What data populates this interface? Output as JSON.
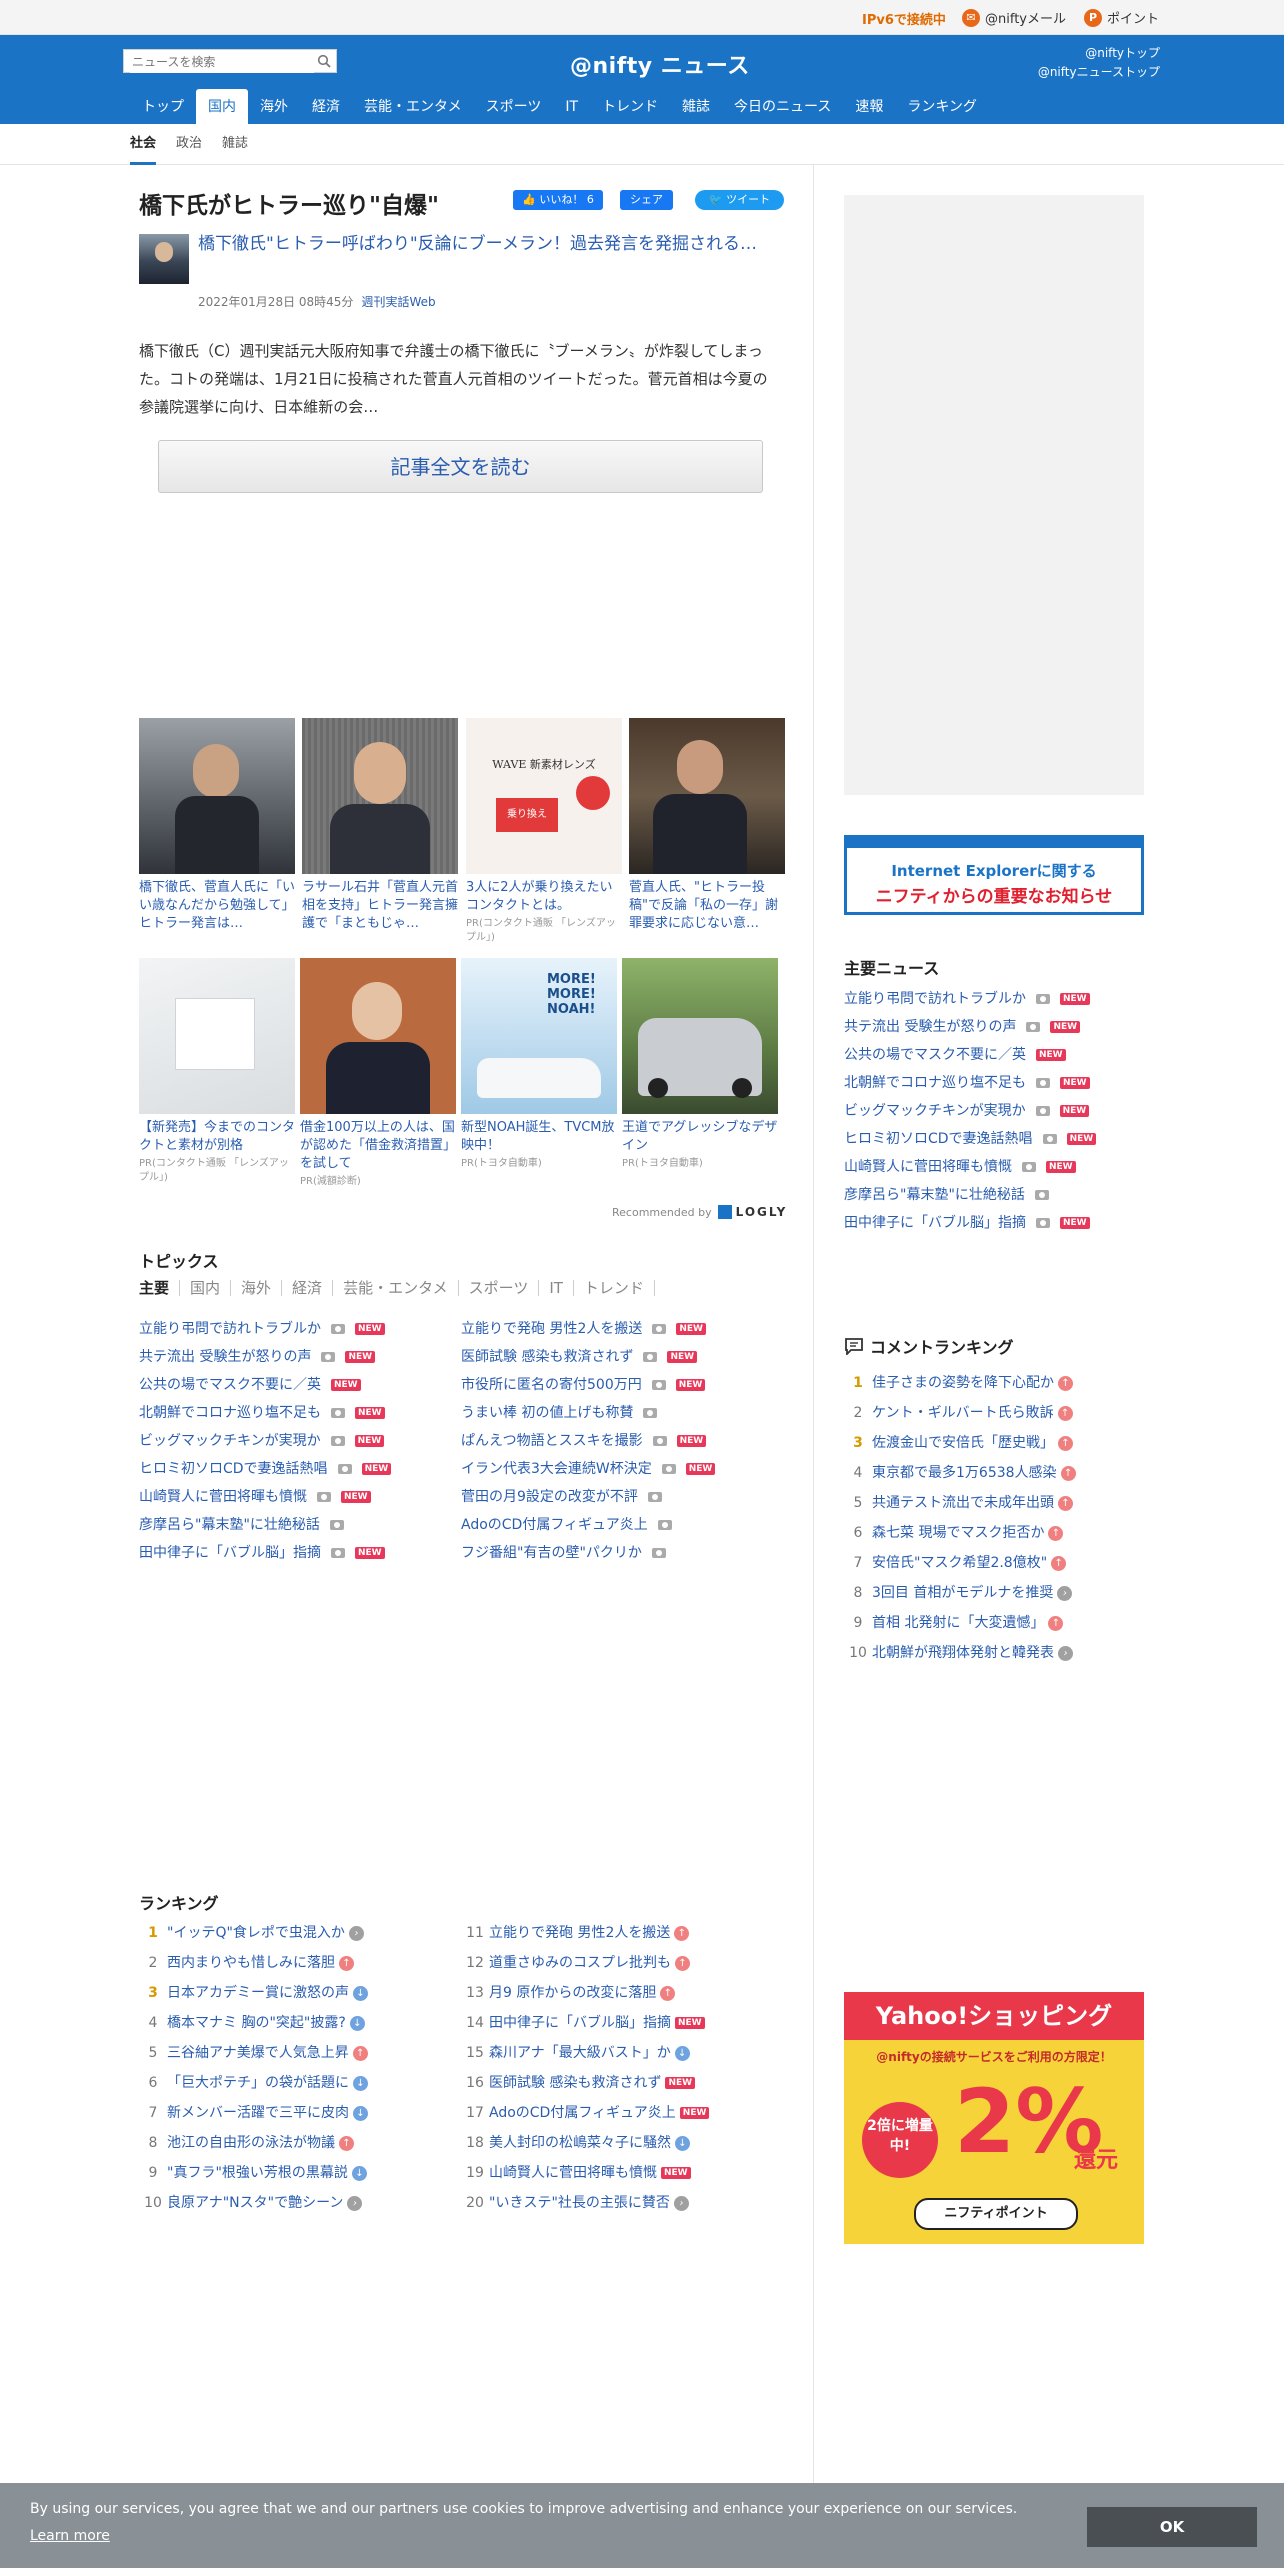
{
  "topbar": {
    "ipv6": "IPv6で接続中",
    "mail": "@niftyメール",
    "point": "ポイント"
  },
  "header": {
    "search_placeholder": "ニュースを検索",
    "logo": "@nifty ニュース",
    "link_top": "@niftyトップ",
    "link_news_top": "@niftyニューストップ"
  },
  "nav": [
    "トップ",
    "国内",
    "海外",
    "経済",
    "芸能・エンタメ",
    "スポーツ",
    "IT",
    "トレンド",
    "雑誌",
    "今日のニュース",
    "速報",
    "ランキング"
  ],
  "subnav": [
    "社会",
    "政治",
    "雑誌"
  ],
  "article": {
    "title": "橋下氏がヒトラー巡り\"自爆\"",
    "like": "いいね！ 6",
    "share": "シェア",
    "tweet": "ツイート",
    "source_title": "橋下徹氏\"ヒトラー呼ばわり\"反論にブーメラン！過去発言を発掘される…",
    "date": "2022年01月28日 08時45分",
    "site": "週刊実話Web",
    "lead": "橋下徹氏（C）週刊実話元大阪府知事で弁護士の橋下徹氏に〝ブーメラン〟が炸裂してしまった。コトの発端は、1月21日に投稿された菅直人元首相のツイートだった。菅元首相は今夏の参議院選挙に向け、日本維新の会…",
    "readmore": "記事全文を読む"
  },
  "recommended": {
    "row1": [
      {
        "caption": "橋下徹氏、菅直人氏に「いい歳なんだから勉強して」ヒトラー発言は…",
        "pr": ""
      },
      {
        "caption": "ラサール石井「菅直人元首相を支持」ヒトラー発言擁護で「まともじゃ…",
        "pr": ""
      },
      {
        "caption": "3人に2人が乗り換えたいコンタクトとは。",
        "pr": "PR(コンタクト通販 「レンズアップル」)"
      },
      {
        "caption": "菅直人氏、\"ヒトラー投稿\"で反論「私の一存」謝罪要求に応じない意…",
        "pr": ""
      }
    ],
    "row2": [
      {
        "caption": "【新発売】今までのコンタクトと素材が別格",
        "pr": "PR(コンタクト通販 「レンズアップル」)"
      },
      {
        "caption": "借金100万以上の人は、国が認めた「借金救済措置」を試して",
        "pr": "PR(減額診断)"
      },
      {
        "caption": "新型NOAH誕生、TVCM放映中！",
        "pr": "PR(トヨタ自動車)"
      },
      {
        "caption": "王道でアグレッシブなデザイン",
        "pr": "PR(トヨタ自動車)"
      }
    ],
    "recby": "Recommended by",
    "logly": "LOGLY"
  },
  "topics": {
    "heading": "トピックス",
    "tabs": [
      "主要",
      "国内",
      "海外",
      "経済",
      "芸能・エンタメ",
      "スポーツ",
      "IT",
      "トレンド"
    ],
    "left": [
      {
        "t": "立能り弔問で訪れトラブルか",
        "new": true
      },
      {
        "t": "共テ流出 受験生が怒りの声",
        "new": true
      },
      {
        "t": "公共の場でマスク不要に／英",
        "new": true
      },
      {
        "t": "北朝鮮でコロナ巡り塩不足も",
        "new": true
      },
      {
        "t": "ビッグマックチキンが実現か",
        "new": true
      },
      {
        "t": "ヒロミ初ソロCDで妻逸話熱唱",
        "new": true
      },
      {
        "t": "山崎賢人に菅田将暉も憤慨",
        "new": true
      },
      {
        "t": "彦摩呂ら\"幕末塾\"に壮絶秘話",
        "new": false
      },
      {
        "t": "田中律子に「バブル脳」指摘",
        "new": true
      }
    ],
    "right": [
      {
        "t": "立能りで発砲 男性2人を搬送",
        "new": true
      },
      {
        "t": "医師試験 感染も救済されず",
        "new": true
      },
      {
        "t": "市役所に匿名の寄付500万円",
        "new": true
      },
      {
        "t": "うまい棒 初の値上げも称賛",
        "new": false
      },
      {
        "t": "ぱんえつ物語とススキを撮影",
        "new": true
      },
      {
        "t": "イラン代表3大会連続W杯決定",
        "new": true
      },
      {
        "t": "菅田の月9設定の改変が不評",
        "new": false
      },
      {
        "t": "AdoのCD付属フィギュア炎上",
        "new": false
      },
      {
        "t": "フジ番組\"有吉の壁\"パクリか",
        "new": false
      }
    ]
  },
  "ranking": {
    "heading": "ランキング",
    "left": [
      {
        "n": "1",
        "t": "\"イッテQ\"食レポで虫混入か",
        "d": "right"
      },
      {
        "n": "2",
        "t": "西内まりやも惜しみに落胆",
        "d": "up"
      },
      {
        "n": "3",
        "t": "日本アカデミー賞に激怒の声",
        "d": "down"
      },
      {
        "n": "4",
        "t": "橋本マナミ 胸の\"突起\"披露?",
        "d": "down"
      },
      {
        "n": "5",
        "t": "三谷紬アナ美爆で人気急上昇",
        "d": "up"
      },
      {
        "n": "6",
        "t": "「巨大ポテチ」の袋が話題に",
        "d": "down"
      },
      {
        "n": "7",
        "t": "新メンバー活躍で三平に皮肉",
        "d": "down"
      },
      {
        "n": "8",
        "t": "池江の自由形の泳法が物議",
        "d": "up"
      },
      {
        "n": "9",
        "t": "\"真フラ\"根強い芳根の黒幕説",
        "d": "down"
      },
      {
        "n": "10",
        "t": "良原アナ\"Nスタ\"で艶シーン",
        "d": "right"
      }
    ],
    "right": [
      {
        "n": "11",
        "t": "立能りで発砲 男性2人を搬送",
        "d": "up"
      },
      {
        "n": "12",
        "t": "道重さゆみのコスプレ批判も",
        "d": "up"
      },
      {
        "n": "13",
        "t": "月9 原作からの改変に落胆",
        "d": "up"
      },
      {
        "n": "14",
        "t": "田中律子に「バブル脳」指摘",
        "d": "new"
      },
      {
        "n": "15",
        "t": "森川アナ「最大級バスト」か",
        "d": "down"
      },
      {
        "n": "16",
        "t": "医師試験 感染も救済されず",
        "d": "new"
      },
      {
        "n": "17",
        "t": "AdoのCD付属フィギュア炎上",
        "d": "new"
      },
      {
        "n": "18",
        "t": "美人封印の松嶋菜々子に騒然",
        "d": "down"
      },
      {
        "n": "19",
        "t": "山崎賢人に菅田将暉も憤慨",
        "d": "new"
      },
      {
        "n": "20",
        "t": "\"いきステ\"社長の主張に賛否",
        "d": "right"
      }
    ]
  },
  "sidebar": {
    "ie_line1": "Internet Explorerに関する",
    "ie_line2": "ニフティからの重要なお知らせ",
    "main_news_heading": "主要ニュース",
    "main_news": [
      {
        "t": "立能り弔問で訪れトラブルか",
        "new": true
      },
      {
        "t": "共テ流出 受験生が怒りの声",
        "new": true
      },
      {
        "t": "公共の場でマスク不要に／英",
        "new": true
      },
      {
        "t": "北朝鮮でコロナ巡り塩不足も",
        "new": true
      },
      {
        "t": "ビッグマックチキンが実現か",
        "new": true
      },
      {
        "t": "ヒロミ初ソロCDで妻逸話熱唱",
        "new": true
      },
      {
        "t": "山崎賢人に菅田将暉も憤慨",
        "new": true
      },
      {
        "t": "彦摩呂ら\"幕末塾\"に壮絶秘話",
        "new": false
      },
      {
        "t": "田中律子に「バブル脳」指摘",
        "new": true
      }
    ],
    "comment_heading": "コメントランキング",
    "comments": [
      {
        "n": "1",
        "t": "佳子さまの姿勢を降下心配か",
        "d": "up"
      },
      {
        "n": "2",
        "t": "ケント・ギルバート氏ら敗訴",
        "d": "up"
      },
      {
        "n": "3",
        "t": "佐渡金山で安倍氏「歴史戦」",
        "d": "up"
      },
      {
        "n": "4",
        "t": "東京都で最多1万6538人感染",
        "d": "up"
      },
      {
        "n": "5",
        "t": "共通テスト流出で未成年出頭",
        "d": "up"
      },
      {
        "n": "6",
        "t": "森七菜 現場でマスク拒否か",
        "d": "up"
      },
      {
        "n": "7",
        "t": "安倍氏\"マスク希望2.8億枚\"",
        "d": "up"
      },
      {
        "n": "8",
        "t": "3回目 首相がモデルナを推奨",
        "d": "right"
      },
      {
        "n": "9",
        "t": "首相 北発射に「大変遺憾」",
        "d": "up"
      },
      {
        "n": "10",
        "t": "北朝鮮が飛翔体発射と韓発表",
        "d": "right"
      }
    ],
    "yahoo": {
      "title": "Yahoo!ショッピング",
      "sub": "@niftyの接続サービスをご利用の方限定！",
      "bai": "2倍に増量中!",
      "pct": "2%",
      "kan": "還元",
      "pill": "ニフティポイント"
    }
  },
  "cookie": {
    "text": "By using our services, you agree that we and our partners use cookies to improve advertising and enhance your experience on our services.",
    "learn": "Learn more",
    "ok": "OK"
  }
}
